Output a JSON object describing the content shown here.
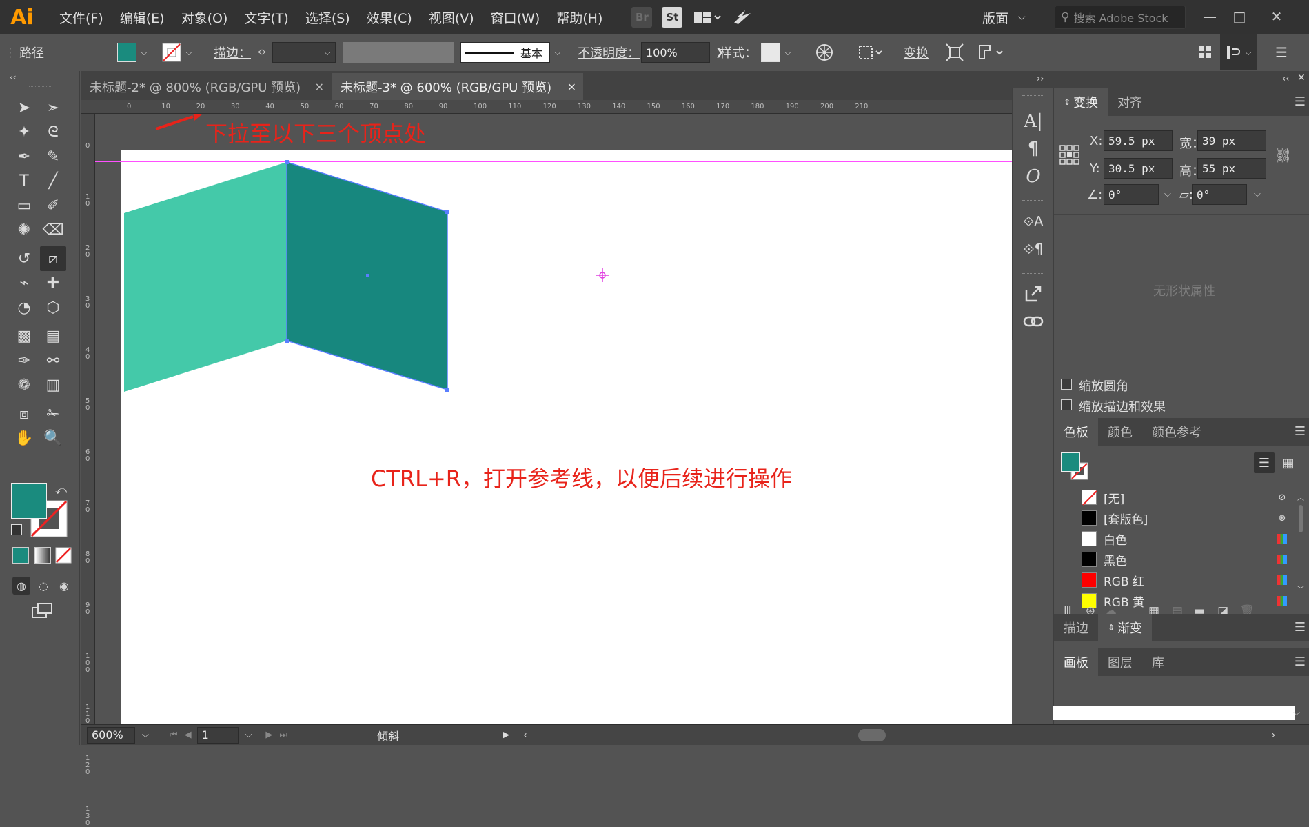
{
  "app": {
    "logo": "Ai"
  },
  "menu": [
    "文件(F)",
    "编辑(E)",
    "对象(O)",
    "文字(T)",
    "选择(S)",
    "效果(C)",
    "视图(V)",
    "窗口(W)",
    "帮助(H)"
  ],
  "menubar_icons": {
    "bridge": "Br",
    "stock": "St"
  },
  "workspace": "版面",
  "search": {
    "placeholder": "搜索 Adobe Stock"
  },
  "window_controls": {
    "minimize": "—",
    "restore": "□",
    "close": "✕"
  },
  "control_bar": {
    "object_type": "路径",
    "fill_color": "#1a8b7e",
    "stroke_label": "描边：",
    "stroke_style": "基本",
    "opacity_label": "不透明度：",
    "opacity_value": "100%",
    "style_label": "样式：",
    "transform_label": "变换"
  },
  "tabs": [
    {
      "label": "未标题-2* @ 800% (RGB/GPU 预览)",
      "close": "×"
    },
    {
      "label": "未标题-3* @ 600% (RGB/GPU 预览)",
      "close": "×"
    }
  ],
  "ruler": {
    "h_ticks": [
      "0",
      "10",
      "20",
      "30",
      "40",
      "50",
      "60",
      "70",
      "80",
      "90",
      "100",
      "110",
      "120",
      "130",
      "140",
      "150",
      "160",
      "170",
      "180",
      "190",
      "200",
      "210"
    ],
    "v_ticks": [
      "0",
      "1 0",
      "2 0",
      "3 0",
      "4 0",
      "5 0",
      "6 0",
      "7 0",
      "8 0",
      "9 0",
      "1 0 0",
      "1 1 0",
      "1 2 0",
      "1 3 0"
    ]
  },
  "canvas": {
    "annotation_top": "下拉至以下三个顶点处",
    "annotation_main": "CTRL+R，打开参考线，以便后续进行操作",
    "shape_left_color": "#44c9a9",
    "shape_right_color": "#17877e",
    "guide_color": "#ff4fff"
  },
  "status": {
    "zoom": "600%",
    "artboard_num": "1",
    "tool_name": "倾斜"
  },
  "toolbar": {
    "fill_color": "#1a8b7e",
    "tools": [
      "selection-tool",
      "direct-selection-tool",
      "magic-wand-tool",
      "lasso-tool",
      "pen-tool",
      "curvature-tool",
      "type-tool",
      "line-tool",
      "rectangle-tool",
      "paintbrush-tool",
      "shaper-tool",
      "eraser-tool",
      "rotate-tool",
      "shear-tool",
      "width-tool",
      "puppet-warp-tool",
      "shape-builder-tool",
      "perspective-grid-tool",
      "mesh-tool",
      "gradient-tool",
      "eyedropper-tool",
      "blend-tool",
      "symbol-sprayer-tool",
      "column-graph-tool",
      "artboard-tool",
      "slice-tool",
      "hand-tool",
      "zoom-tool"
    ]
  },
  "transform_panel": {
    "tabs": [
      "变换",
      "对齐"
    ],
    "x_label": "X:",
    "x_value": "59.5 px",
    "w_label": "宽：",
    "w_value": "39 px",
    "y_label": "Y:",
    "y_value": "30.5 px",
    "h_label": "高：",
    "h_value": "55 px",
    "angle_value": "0°",
    "shear_value": "0°",
    "no_shape": "无形状属性",
    "scale_corners": "缩放圆角",
    "scale_strokes": "缩放描边和效果"
  },
  "swatches_panel": {
    "tabs": [
      "色板",
      "颜色",
      "颜色参考"
    ],
    "items": [
      {
        "name": "[无]",
        "color": "none"
      },
      {
        "name": "[套版色]",
        "color": "#000000"
      },
      {
        "name": "白色",
        "color": "#ffffff"
      },
      {
        "name": "黑色",
        "color": "#000000"
      },
      {
        "name": "RGB 红",
        "color": "#ff0000"
      },
      {
        "name": "RGB 黄",
        "color": "#ffff00"
      }
    ]
  },
  "stroke_gradient_panel": {
    "tabs": [
      "描边",
      "渐变"
    ]
  },
  "artboard_panel": {
    "tabs": [
      "画板",
      "图层",
      "库"
    ]
  }
}
